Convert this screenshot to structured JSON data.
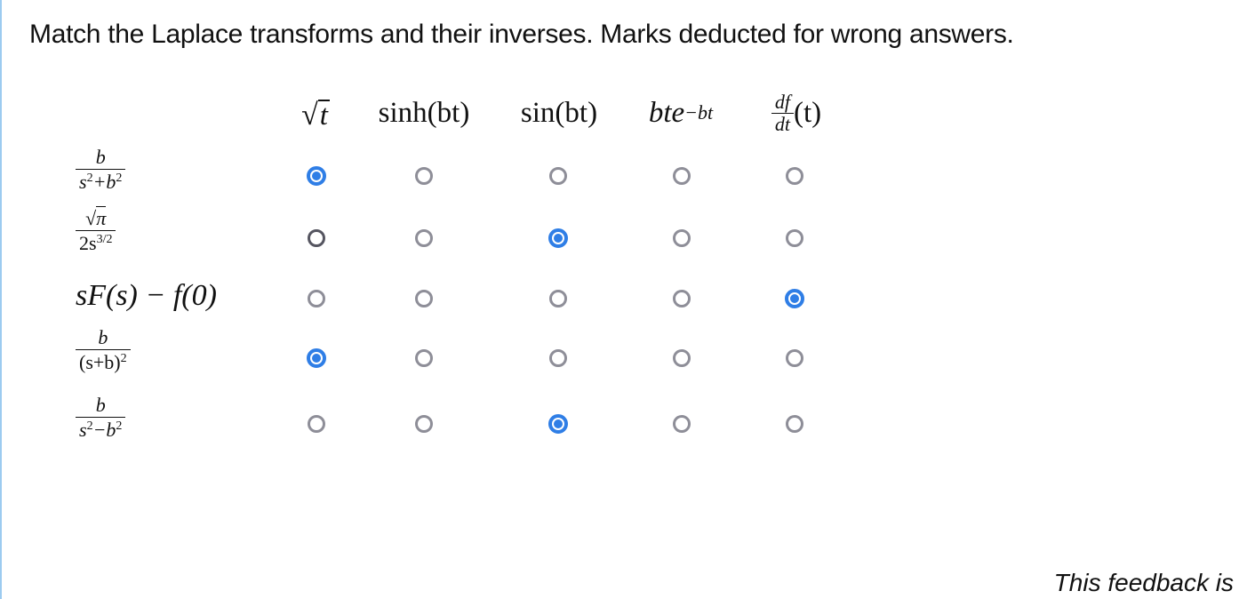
{
  "prompt": "Match the Laplace transforms and their inverses. Marks deducted for wrong answers.",
  "columns": [
    {
      "id": "sqrt-t",
      "label": "t"
    },
    {
      "id": "sinh",
      "label": "sinh(bt)"
    },
    {
      "id": "sin",
      "label": "sin(bt)"
    },
    {
      "id": "bte",
      "base": "bte",
      "exp": "−bt"
    },
    {
      "id": "dfdt",
      "num": "df",
      "den": "dt",
      "tail": "(t)"
    }
  ],
  "rows": [
    {
      "id": "r1",
      "num": "b",
      "den_base": "s",
      "den_rest": "+b",
      "den_exp1": "2",
      "den_exp2": "2",
      "selected": 0
    },
    {
      "id": "r2",
      "num": "π",
      "den": "2s",
      "den_exp": "3/2",
      "selected": 2
    },
    {
      "id": "r3",
      "expr": "sF(s) − f(0)",
      "selected": 4
    },
    {
      "id": "r4",
      "num": "b",
      "den": "(s+b)",
      "den_exp": "2",
      "selected": 0
    },
    {
      "id": "r5",
      "num": "b",
      "den_base": "s",
      "den_rest": "−b",
      "den_exp1": "2",
      "den_exp2": "2",
      "selected": 2
    }
  ],
  "feedback": "This feedback is",
  "colors": {
    "accent": "#2f7ee6",
    "radio_border": "#8e8e98",
    "left_rule": "#9ccbf0"
  }
}
